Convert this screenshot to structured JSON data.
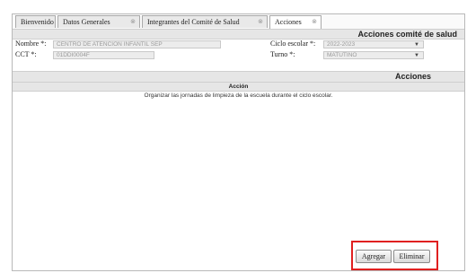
{
  "tabs": [
    {
      "label": "Bienvenido",
      "closable": false
    },
    {
      "label": "Datos Generales",
      "closable": true
    },
    {
      "label": "Integrantes del Comité de Salud",
      "closable": true
    },
    {
      "label": "Acciones",
      "closable": true,
      "active": true
    }
  ],
  "section1_title": "Acciones comité de salud",
  "form": {
    "nombre_label": "Nombre *:",
    "nombre_value": "CENTRO DE ATENCIÓN INFANTIL SEP",
    "cct_label": "CCT *:",
    "cct_value": "01DDI0004F",
    "ciclo_label": "Ciclo escolar *:",
    "ciclo_value": "2022-2023",
    "turno_label": "Turno *:",
    "turno_value": "MATUTINO"
  },
  "section2_title": "Acciones",
  "table": {
    "column_header": "Acción",
    "rows": [
      "Organizar las jornadas de limpieza de la escuela durante el ciclo escolar."
    ]
  },
  "buttons": {
    "add_label": "Agregar",
    "delete_label": "Eliminar"
  },
  "icons": {
    "tab_close": "close-icon",
    "dropdown": "chevron-down-icon"
  },
  "colors": {
    "highlight_border": "#e02020",
    "header_bg": "#e6e6e6"
  }
}
